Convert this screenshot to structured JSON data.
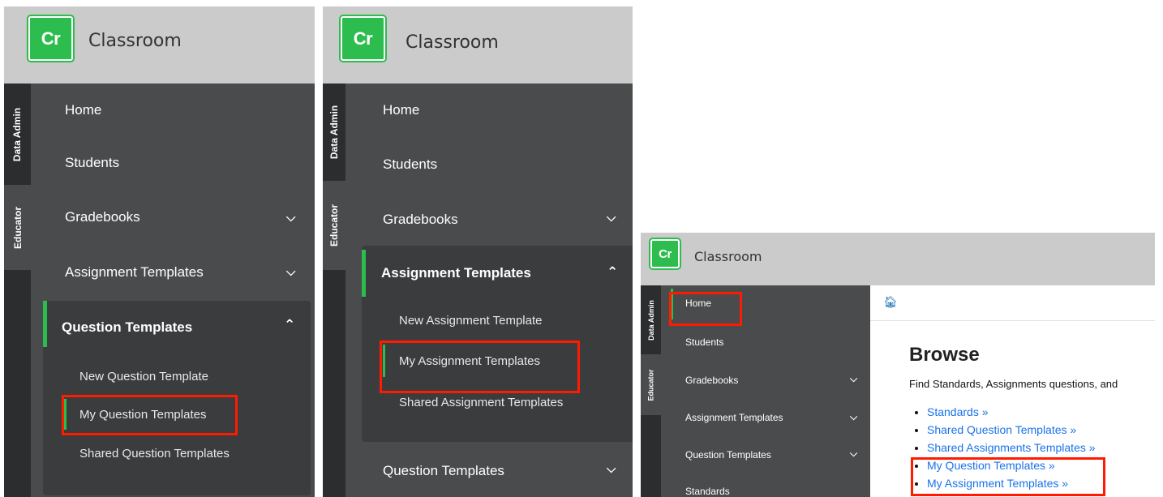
{
  "app": {
    "logo_text": "Cr",
    "title": "Classroom"
  },
  "rail_tabs": {
    "data_admin": "Data Admin",
    "educator": "Educator"
  },
  "panel1": {
    "nav": {
      "home": "Home",
      "students": "Students",
      "gradebooks": "Gradebooks",
      "assignment_templates": "Assignment Templates",
      "question_templates": "Question Templates"
    },
    "submenu": [
      "New Question Template",
      "My Question Templates",
      "Shared Question Templates"
    ]
  },
  "panel2": {
    "nav": {
      "home": "Home",
      "students": "Students",
      "gradebooks": "Gradebooks",
      "assignment_templates": "Assignment Templates",
      "question_templates": "Question Templates"
    },
    "submenu": [
      "New Assignment Template",
      "My Assignment Templates",
      "Shared Assignment Templates"
    ]
  },
  "panel3": {
    "nav": {
      "home": "Home",
      "students": "Students",
      "gradebooks": "Gradebooks",
      "assignment_templates": "Assignment Templates",
      "question_templates": "Question Templates",
      "standards": "Standards"
    },
    "heading": "Browse",
    "description": "Find Standards, Assignments questions, and",
    "links": [
      "Standards »",
      "Shared Question Templates »",
      "Shared Assignments Templates »",
      "My Question Templates »",
      "My Assignment Templates »"
    ]
  },
  "icons": {
    "chevron_down": "chevron-down-icon",
    "chevron_up": "chevron-up-icon",
    "home": "home-icon"
  },
  "colors": {
    "accent": "#2dbc4e",
    "sidebar": "#4a4b4d",
    "rail": "#2c2d2f",
    "header": "#cbcbcb",
    "highlight": "#ff1a00",
    "link": "#1a73e8"
  }
}
